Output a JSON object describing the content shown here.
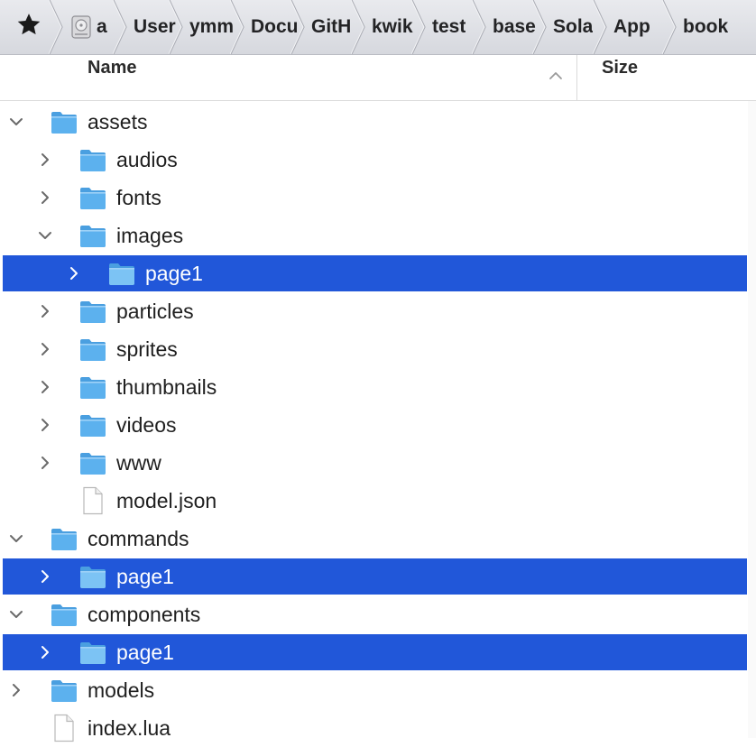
{
  "breadcrumb": {
    "items": [
      {
        "label": "",
        "icon": "star-icon"
      },
      {
        "label": "a",
        "icon": "disk-icon"
      },
      {
        "label": "User"
      },
      {
        "label": "ymm"
      },
      {
        "label": "Docu"
      },
      {
        "label": "GitH"
      },
      {
        "label": "kwik"
      },
      {
        "label": "test"
      },
      {
        "label": "base"
      },
      {
        "label": "Sola"
      },
      {
        "label": "App"
      },
      {
        "label": "book"
      }
    ]
  },
  "columns": {
    "name": "Name",
    "size": "Size",
    "sort_icon": "chevron-up-icon"
  },
  "colors": {
    "selection": "#2157d9",
    "folder": "#5cb1ee",
    "chevron": "#6a6a6a"
  },
  "rows": [
    {
      "label": "assets",
      "type": "folder",
      "level": 0,
      "expanded": true,
      "selected": false
    },
    {
      "label": "audios",
      "type": "folder",
      "level": 1,
      "expanded": false,
      "selected": false
    },
    {
      "label": "fonts",
      "type": "folder",
      "level": 1,
      "expanded": false,
      "selected": false
    },
    {
      "label": "images",
      "type": "folder",
      "level": 1,
      "expanded": true,
      "selected": false
    },
    {
      "label": "page1",
      "type": "folder",
      "level": 2,
      "expanded": false,
      "selected": true
    },
    {
      "label": "particles",
      "type": "folder",
      "level": 1,
      "expanded": false,
      "selected": false
    },
    {
      "label": "sprites",
      "type": "folder",
      "level": 1,
      "expanded": false,
      "selected": false
    },
    {
      "label": "thumbnails",
      "type": "folder",
      "level": 1,
      "expanded": false,
      "selected": false
    },
    {
      "label": "videos",
      "type": "folder",
      "level": 1,
      "expanded": false,
      "selected": false
    },
    {
      "label": "www",
      "type": "folder",
      "level": 1,
      "expanded": false,
      "selected": false
    },
    {
      "label": "model.json",
      "type": "file",
      "level": 1,
      "expanded": false,
      "selected": false
    },
    {
      "label": "commands",
      "type": "folder",
      "level": 0,
      "expanded": true,
      "selected": false
    },
    {
      "label": "page1",
      "type": "folder",
      "level": 1,
      "expanded": false,
      "selected": true
    },
    {
      "label": "components",
      "type": "folder",
      "level": 0,
      "expanded": true,
      "selected": false
    },
    {
      "label": "page1",
      "type": "folder",
      "level": 1,
      "expanded": false,
      "selected": true
    },
    {
      "label": "models",
      "type": "folder",
      "level": 0,
      "expanded": false,
      "selected": false
    },
    {
      "label": "index.lua",
      "type": "file",
      "level": 0,
      "expanded": false,
      "selected": false
    }
  ]
}
